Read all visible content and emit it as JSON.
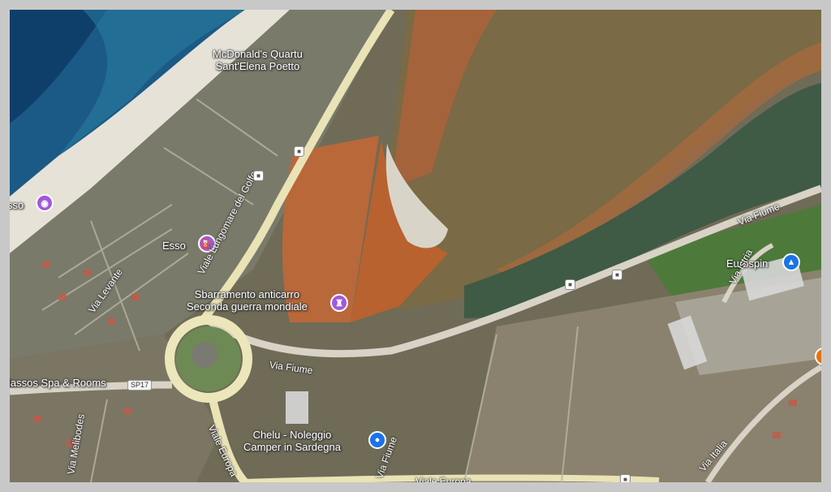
{
  "map": {
    "type": "satellite",
    "places": {
      "mcdonalds": "McDonald's Quartu\nSant'Elena Poetto",
      "esso_left": "sso",
      "esso": "Esso",
      "sbarramento": "Sbarramento anticarro\nSeconda guerra mondiale",
      "spa": "lassos Spa & Rooms",
      "chelu": "Chelu - Noleggio\nCamper in Sardegna",
      "eurospin": "Eurospin"
    },
    "roads": {
      "lungomare": "Viale Lungomare del Golfo",
      "via_levante": "Via Levante",
      "via_fiume_1": "Via Fiume",
      "via_fiume_2": "Via Fiume",
      "via_fiume_3": "Via Fiume",
      "viale_europa": "Viale Europa",
      "via_melibodes": "Via Melibodes",
      "via_italia": "Via Italia",
      "via_istria": "Via Istria",
      "viale_bottom": "Viale Europa",
      "shield_sp17": "SP17"
    },
    "colors": {
      "sea": "#1b5a86",
      "lagoon": "#7a6a45",
      "salt_pan": "#b9683a",
      "road": "#e9e3b6",
      "pin_purple": "#a259d9",
      "pin_blue": "#1a73e8"
    },
    "icons": {
      "camera": "camera-icon",
      "fuel": "gas-station-icon",
      "monument": "monument-icon",
      "lock": "lock-icon",
      "cart": "shopping-cart-icon",
      "bus": "bus-stop-icon"
    }
  }
}
